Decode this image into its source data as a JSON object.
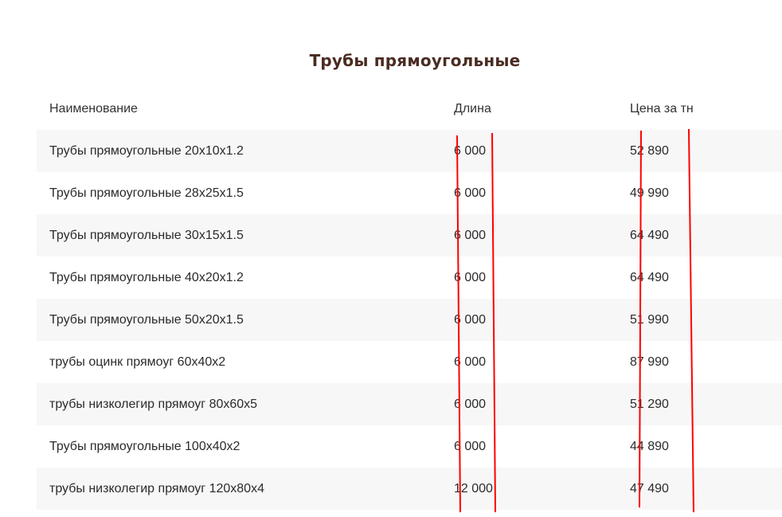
{
  "title": "Трубы прямоугольные",
  "table": {
    "headers": {
      "name": "Наименование",
      "length": "Длина",
      "price": "Цена за тн"
    },
    "rows": [
      {
        "name": "Трубы  прямоугольные 20х10х1.2",
        "length": "6 000",
        "price": "52 890"
      },
      {
        "name": "Трубы  прямоугольные 28х25х1.5",
        "length": "6 000",
        "price": "49 990"
      },
      {
        "name": "Трубы  прямоугольные 30х15х1.5",
        "length": "6 000",
        "price": "64 490"
      },
      {
        "name": "Трубы  прямоугольные 40х20х1.2",
        "length": "6 000",
        "price": "64 490"
      },
      {
        "name": "Трубы  прямоугольные 50х20х1.5",
        "length": "6 000",
        "price": "51 990"
      },
      {
        "name": "трубы  оцинк прямоуг 60х40х2",
        "length": "6 000",
        "price": "87 990"
      },
      {
        "name": "трубы  низколегир прямоуг 80х60х5",
        "length": "6 000",
        "price": "51 290"
      },
      {
        "name": "Трубы  прямоугольные 100х40х2",
        "length": "6 000",
        "price": "44 890"
      },
      {
        "name": "трубы  низколегир прямоуг 120х80х4",
        "length": "12 000",
        "price": "47 490"
      }
    ]
  },
  "colors": {
    "title": "#4a2c22",
    "row_stripe": "#f7f7f7",
    "annotation_lines": "#ff0000"
  }
}
